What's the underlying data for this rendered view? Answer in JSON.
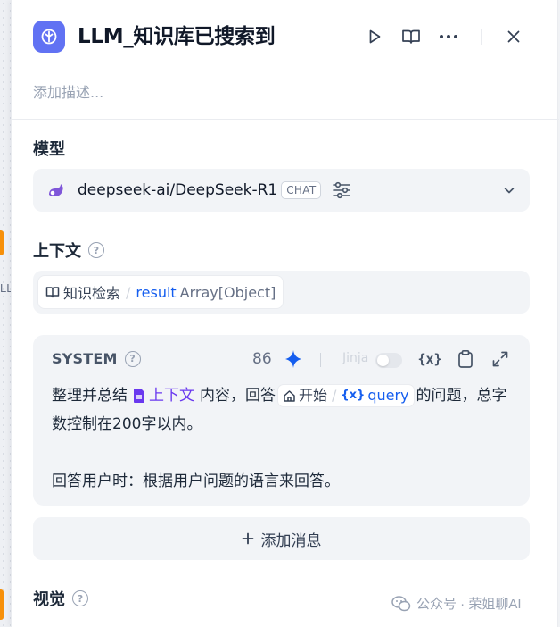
{
  "node": {
    "title": "LLM_知识库已搜索到",
    "description_placeholder": "添加描述..."
  },
  "background_canvas": {
    "partial_label": "LL"
  },
  "model_section": {
    "label": "模型",
    "model_name": "deepseek-ai/DeepSeek-R1",
    "mode_badge": "CHAT"
  },
  "context_section": {
    "label": "上下文",
    "variable": {
      "node_name": "知识检索",
      "separator": "/",
      "var_name": "result",
      "var_type": "Array[Object]"
    }
  },
  "prompt": {
    "role": "SYSTEM",
    "char_count": "86",
    "jinja_label": "Jinja",
    "jinja_enabled": false,
    "text_part1": "整理并总结",
    "context_ref": "上下文",
    "text_part2": "内容，回答",
    "start_node": "开始",
    "separator": "/",
    "query_var": "query",
    "text_part3": "的问题，总字数控制在200字以内。",
    "text_part4": "回答用户时：根据用户问题的语言来回答。",
    "var_icon": "{x}"
  },
  "add_message_label": "添加消息",
  "vision_section": {
    "label": "视觉"
  },
  "watermark": "公众号 · 荣姐聊AI",
  "colors": {
    "node_icon_bg": "#6172f3",
    "context_purple": "#6938ef",
    "variable_blue": "#155eef",
    "model_logo": "#7f56d9"
  },
  "icons": {
    "node": "llm-node-icon",
    "run": "play-icon",
    "docs": "book-open-icon",
    "more": "more-dots-icon",
    "close": "close-icon",
    "model_logo": "deepseek-logo-icon",
    "model_params": "sliders-icon",
    "dropdown": "chevron-down-icon",
    "help": "help-circle-icon",
    "generator": "sparkle-icon",
    "insert_var": "variable-icon",
    "copy": "clipboard-icon",
    "expand": "expand-icon"
  }
}
